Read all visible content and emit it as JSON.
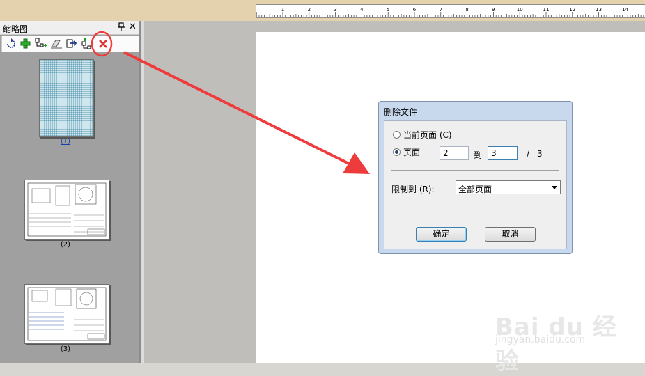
{
  "ruler": {
    "numbers": [
      "1",
      "2",
      "3",
      "4",
      "5",
      "6",
      "7",
      "8",
      "9",
      "10",
      "11",
      "12",
      "13",
      "14"
    ]
  },
  "panel": {
    "title": "缩略图",
    "close_glyph": "✕",
    "thumbnails": [
      {
        "label": "(1)",
        "selected": true
      },
      {
        "label": "(2)",
        "selected": false
      },
      {
        "label": "(3)",
        "selected": false
      }
    ],
    "toolbar_icons": [
      "rotate-icon",
      "add-page-icon",
      "insert-page-icon",
      "erase-icon",
      "export-page-icon",
      "extract-page-icon",
      "delete-page-icon"
    ]
  },
  "dialog": {
    "title": "删除文件",
    "current_page_label": "当前页面 (C)",
    "pages_label": "页面",
    "from_value": "2",
    "to_label": "到",
    "to_value": "3",
    "separator": "/",
    "total_pages": "3",
    "limit_label": "限制到 (R):",
    "limit_value": "全部页面",
    "ok_label": "确定",
    "cancel_label": "取消"
  },
  "watermark": {
    "logo": "Bai du 经验",
    "url": "jingyan.baidu.com"
  },
  "colors": {
    "annotation": "#ee3b3b",
    "dialog_frame": "#c8d9ee",
    "panel_bg": "#a0a0a0"
  }
}
